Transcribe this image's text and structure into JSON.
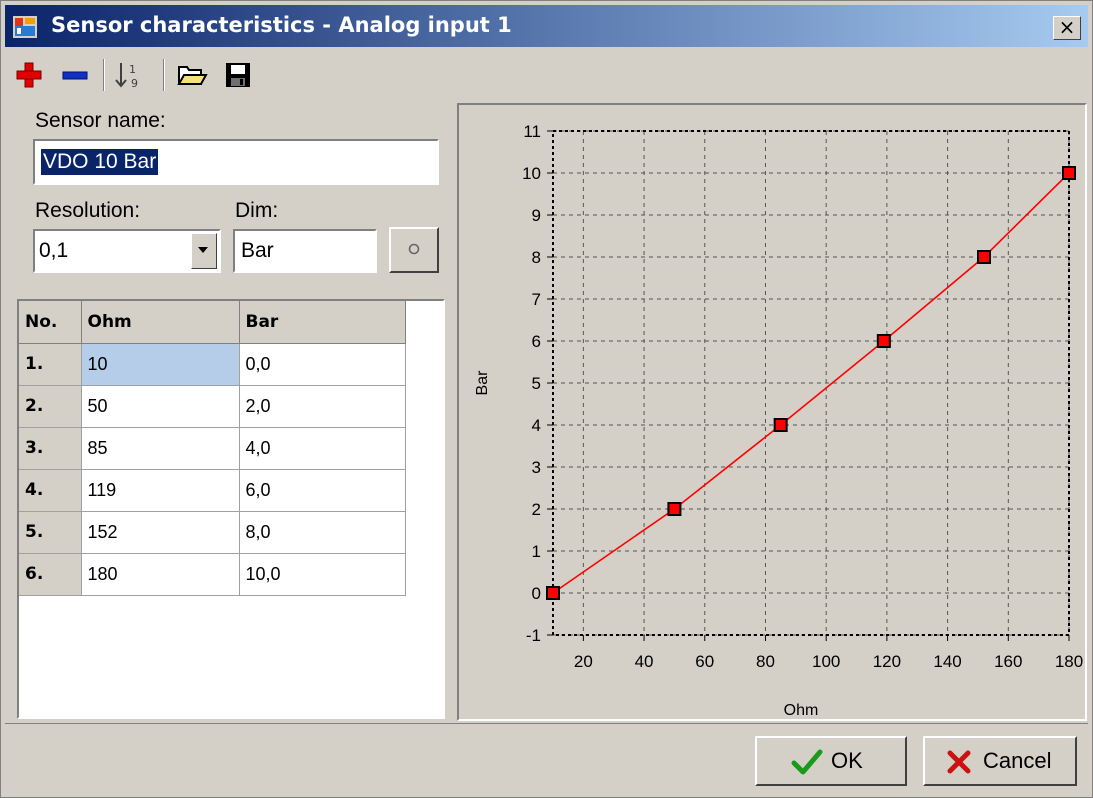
{
  "window": {
    "title": "Sensor characteristics - Analog input 1",
    "close_label": "×"
  },
  "toolbar": {
    "add_icon": "plus-icon",
    "remove_icon": "minus-icon",
    "sort_icon": "sort-numeric-icon",
    "open_icon": "folder-open-icon",
    "save_icon": "floppy-disk-icon"
  },
  "form": {
    "sensor_name_label": "Sensor name:",
    "sensor_name_value": "VDO 10 Bar",
    "resolution_label": "Resolution:",
    "resolution_value": "0,1",
    "dim_label": "Dim:",
    "dim_value": "Bar"
  },
  "table": {
    "headers": [
      "No.",
      "Ohm",
      "Bar"
    ],
    "rows": [
      {
        "no": "1.",
        "ohm": "10",
        "bar": "0,0"
      },
      {
        "no": "2.",
        "ohm": "50",
        "bar": "2,0"
      },
      {
        "no": "3.",
        "ohm": "85",
        "bar": "4,0"
      },
      {
        "no": "4.",
        "ohm": "119",
        "bar": "6,0"
      },
      {
        "no": "5.",
        "ohm": "152",
        "bar": "8,0"
      },
      {
        "no": "6.",
        "ohm": "180",
        "bar": "10,0"
      }
    ]
  },
  "chart_data": {
    "type": "line",
    "x": [
      10,
      50,
      85,
      119,
      152,
      180
    ],
    "series": [
      {
        "values": [
          0,
          2,
          4,
          6,
          8,
          10
        ]
      }
    ],
    "xlabel": "Ohm",
    "ylabel": "Bar",
    "xlim": [
      10,
      180
    ],
    "ylim": [
      -1,
      11
    ],
    "xticks": [
      20,
      40,
      60,
      80,
      100,
      120,
      140,
      160,
      180
    ],
    "yticks": [
      -1,
      0,
      1,
      2,
      3,
      4,
      5,
      6,
      7,
      8,
      9,
      10,
      11
    ],
    "grid": true,
    "line_color": "#ff0000",
    "marker_color": "#ff0000"
  },
  "buttons": {
    "ok": "OK",
    "cancel": "Cancel"
  },
  "colors": {
    "title_start": "#0a246a",
    "title_end": "#a6caf0",
    "face": "#d4d0c8",
    "selection": "#0a246a",
    "ok_check": "#1a9a1a",
    "cancel_x": "#cc1111"
  }
}
